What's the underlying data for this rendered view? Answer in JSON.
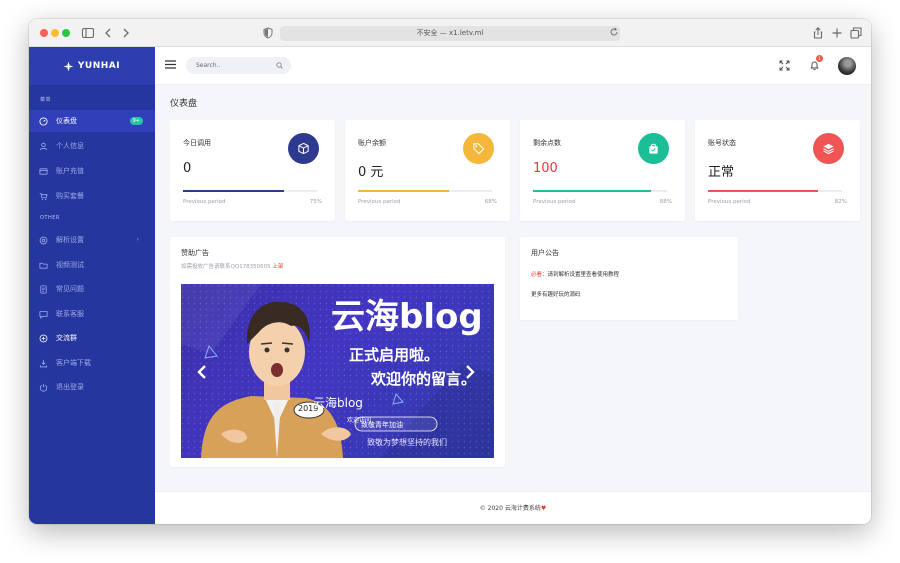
{
  "browser": {
    "address": "不安全 — x1.letv.ml"
  },
  "sidebar": {
    "brand": "YUNHAI",
    "section1": "菜单",
    "section2": "OTHER",
    "items": [
      {
        "label": "仪表盘",
        "badge": "9+"
      },
      {
        "label": "个人信息"
      },
      {
        "label": "账户充值"
      },
      {
        "label": "购买套餐"
      },
      {
        "label": "解析设置"
      },
      {
        "label": "视频测试"
      },
      {
        "label": "常见问题"
      },
      {
        "label": "联系客服"
      },
      {
        "label": "交流群"
      },
      {
        "label": "客户端下载"
      },
      {
        "label": "退出登录"
      }
    ]
  },
  "topbar": {
    "search_placeholder": "Search..",
    "notification_count": "1"
  },
  "page_title": "仪表盘",
  "stats": [
    {
      "title": "今日调用",
      "value": "0",
      "footer": "Previous period",
      "percent": "75%",
      "progress": 0.75,
      "color": "#2e3a8f"
    },
    {
      "title": "账户余额",
      "value": "0 元",
      "footer": "Previous period",
      "percent": "68%",
      "progress": 0.68,
      "color": "#f4b73c"
    },
    {
      "title": "剩余点数",
      "value": "100",
      "footer": "Previous period",
      "percent": "88%",
      "progress": 0.88,
      "color": "#1bbf97"
    },
    {
      "title": "账号状态",
      "value": "正常",
      "footer": "Previous period",
      "percent": "82%",
      "progress": 0.82,
      "color": "#f05454"
    }
  ],
  "sponsor": {
    "title": "赞助广告",
    "subtitle": "如需投放广告请联系QQ178350505",
    "subtitle_tag": "上架",
    "banner": {
      "headline": "云海blog",
      "line1": "正式启用啦。",
      "line2": "欢迎你的留言。",
      "year": "2019",
      "brand": "云海blog",
      "welcome": "欢迎访问",
      "badge": "致敬青年加油",
      "slogan": "致敬为梦想坚持的我们"
    }
  },
  "notice": {
    "title": "用户公告",
    "line1_label": "必看：",
    "line1_text": "请到解析设置里查看使用教程",
    "line2_text": "更多有趣好玩的源码"
  },
  "footer": {
    "text": "© 2020 云海计费系统"
  }
}
